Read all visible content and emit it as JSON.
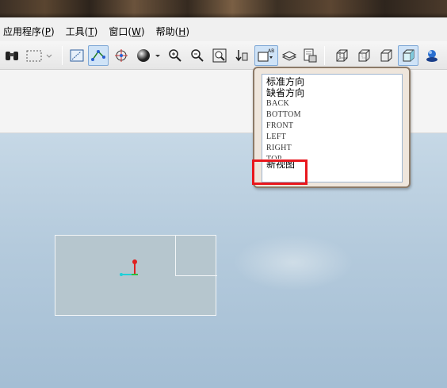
{
  "menubar": {
    "items": [
      {
        "label": "应用程序(",
        "mnemonic": "P",
        "close": ")"
      },
      {
        "label": "工具(",
        "mnemonic": "T",
        "close": ")"
      },
      {
        "label": "窗口(",
        "mnemonic": "W",
        "close": ")"
      },
      {
        "label": "帮助(",
        "mnemonic": "H",
        "close": ")"
      }
    ]
  },
  "toolbar": {
    "icons": [
      "binoculars-icon",
      "box-select-icon",
      "select-dropdown-icon",
      "sketch-display-icon",
      "datum-points-icon",
      "spin-center-icon",
      "appearance-sphere-icon",
      "appearance-dropdown-icon",
      "zoom-in-icon",
      "zoom-out-icon",
      "refit-icon",
      "reorient-icon",
      "saved-views-icon",
      "layers-icon",
      "view-manager-icon",
      "wireframe-icon",
      "hidden-line-icon",
      "no-hidden-icon",
      "shading-icon",
      "model-tree-icon"
    ]
  },
  "view_popup": {
    "items": [
      "标准方向",
      "缺省方向",
      "BACK",
      "BOTTOM",
      "FRONT",
      "LEFT",
      "RIGHT",
      "TOP",
      "新视图"
    ],
    "highlighted": "新视图",
    "highlight_color": "#e8171d"
  }
}
